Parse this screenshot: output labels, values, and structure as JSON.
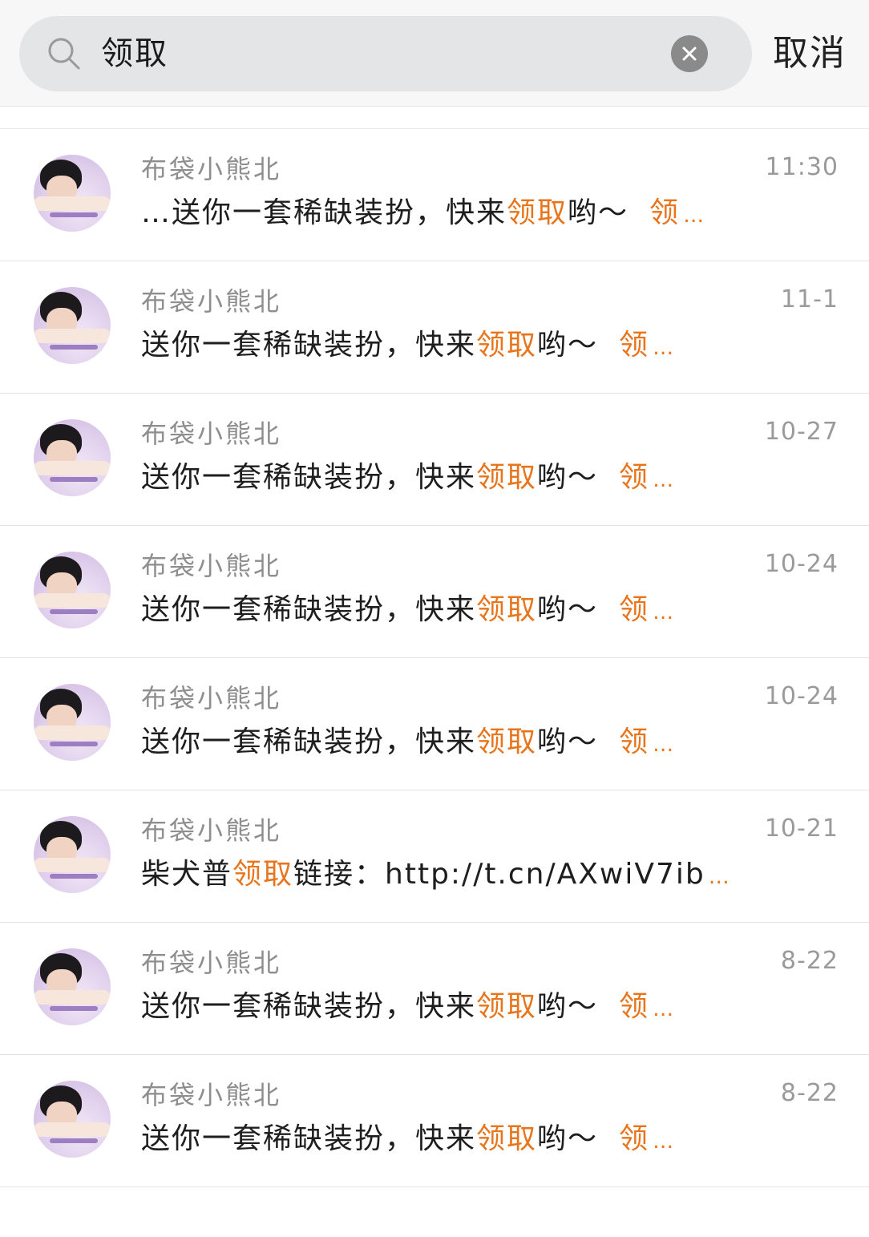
{
  "search": {
    "query": "领取",
    "cancel_label": "取消"
  },
  "colors": {
    "highlight": "#e8741c",
    "search_bg": "#e4e5e7"
  },
  "results": [
    {
      "name": "布袋小熊北",
      "time": "11:30",
      "before": "…送你一套稀缺装扮，快来",
      "match": "领取",
      "after": "哟～",
      "tail": "领",
      "ellipsis": "…"
    },
    {
      "name": "布袋小熊北",
      "time": "11-1",
      "before": "送你一套稀缺装扮，快来",
      "match": "领取",
      "after": "哟～",
      "tail": "领",
      "ellipsis": "…"
    },
    {
      "name": "布袋小熊北",
      "time": "10-27",
      "before": "送你一套稀缺装扮，快来",
      "match": "领取",
      "after": "哟～",
      "tail": "领",
      "ellipsis": "…"
    },
    {
      "name": "布袋小熊北",
      "time": "10-24",
      "before": "送你一套稀缺装扮，快来",
      "match": "领取",
      "after": "哟～",
      "tail": "领",
      "ellipsis": "…"
    },
    {
      "name": "布袋小熊北",
      "time": "10-24",
      "before": "送你一套稀缺装扮，快来",
      "match": "领取",
      "after": "哟～",
      "tail": "领",
      "ellipsis": "…"
    },
    {
      "name": "布袋小熊北",
      "time": "10-21",
      "before": "柴犬普",
      "match": "领取",
      "after": "链接：http://t.cn/AXwiV7ib",
      "tail": "",
      "ellipsis": "…"
    },
    {
      "name": "布袋小熊北",
      "time": "8-22",
      "before": "送你一套稀缺装扮，快来",
      "match": "领取",
      "after": "哟～",
      "tail": "领",
      "ellipsis": "…"
    },
    {
      "name": "布袋小熊北",
      "time": "8-22",
      "before": "送你一套稀缺装扮，快来",
      "match": "领取",
      "after": "哟～",
      "tail": "领",
      "ellipsis": "…"
    }
  ]
}
